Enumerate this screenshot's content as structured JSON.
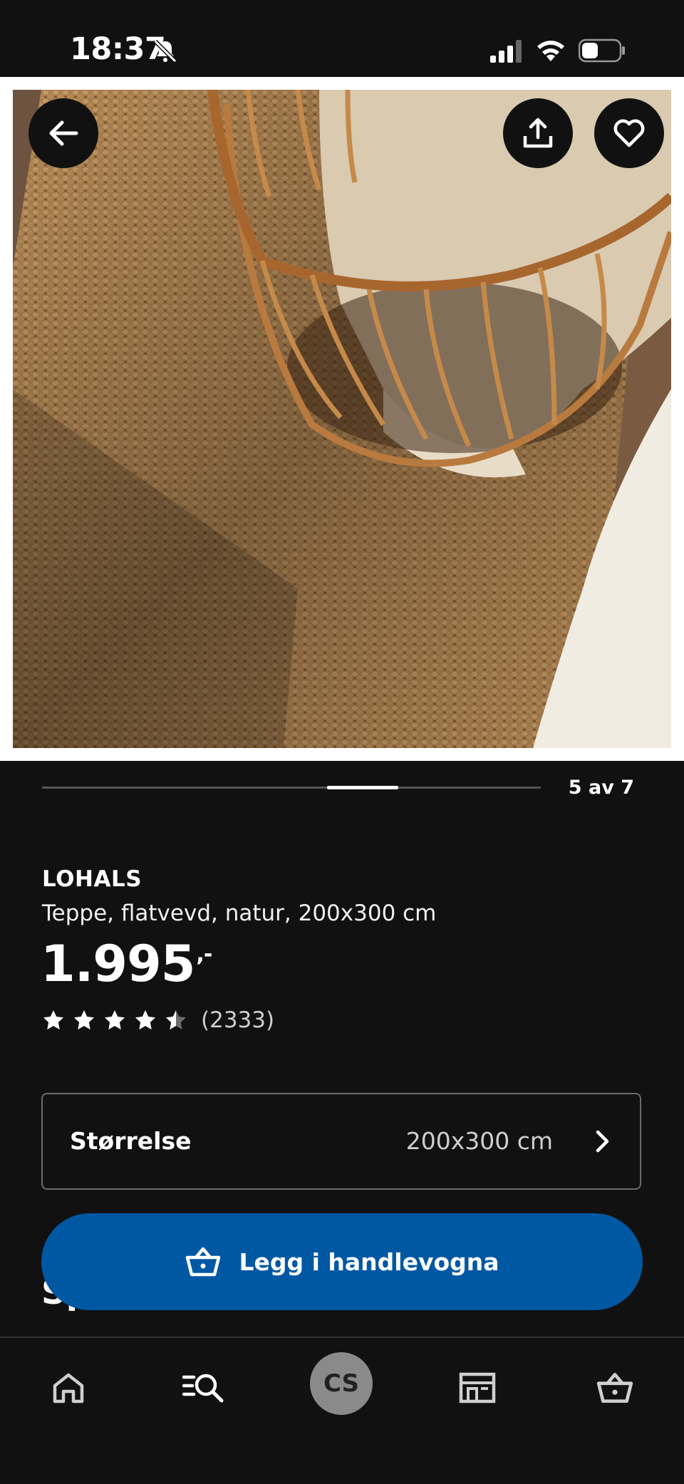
{
  "status_bar": {
    "time": "18:37",
    "mute_icon": "bell-slash-icon",
    "signal_icon": "cellular-signal-icon",
    "wifi_icon": "wifi-icon",
    "battery_icon": "battery-icon"
  },
  "gallery": {
    "image_description_icon": "jute-rug-with-rattan-basket-photo",
    "current_index": 5,
    "total": 7,
    "pager_label": "5 av 7"
  },
  "actions": {
    "back_icon": "arrow-left-icon",
    "share_icon": "share-icon",
    "favorite_icon": "heart-icon"
  },
  "product": {
    "brand": "LOHALS",
    "description": "Teppe, flatvevd, natur, 200x300 cm",
    "price": "1.995",
    "price_suffix": ",-",
    "rating": 4.5,
    "rating_max": 5,
    "rating_count": "(2333)"
  },
  "size_selector": {
    "label": "Størrelse",
    "value": "200x300 cm",
    "chevron_icon": "chevron-right-icon"
  },
  "cart_button": {
    "label": "Legg i handlevogna",
    "icon": "shopping-basket-icon",
    "color": "#0058a3"
  },
  "partially_visible_heading": "Sp",
  "tab_bar": {
    "items": [
      {
        "name": "home",
        "icon": "home-icon"
      },
      {
        "name": "search",
        "icon": "search-icon"
      },
      {
        "name": "profile",
        "initials": "CS"
      },
      {
        "name": "store",
        "icon": "store-icon"
      },
      {
        "name": "cart",
        "icon": "shopping-basket-icon"
      }
    ]
  },
  "colors": {
    "background": "#111111",
    "accent_blue": "#0058a3",
    "text": "#ffffff",
    "muted_text": "#cfcfcf"
  }
}
